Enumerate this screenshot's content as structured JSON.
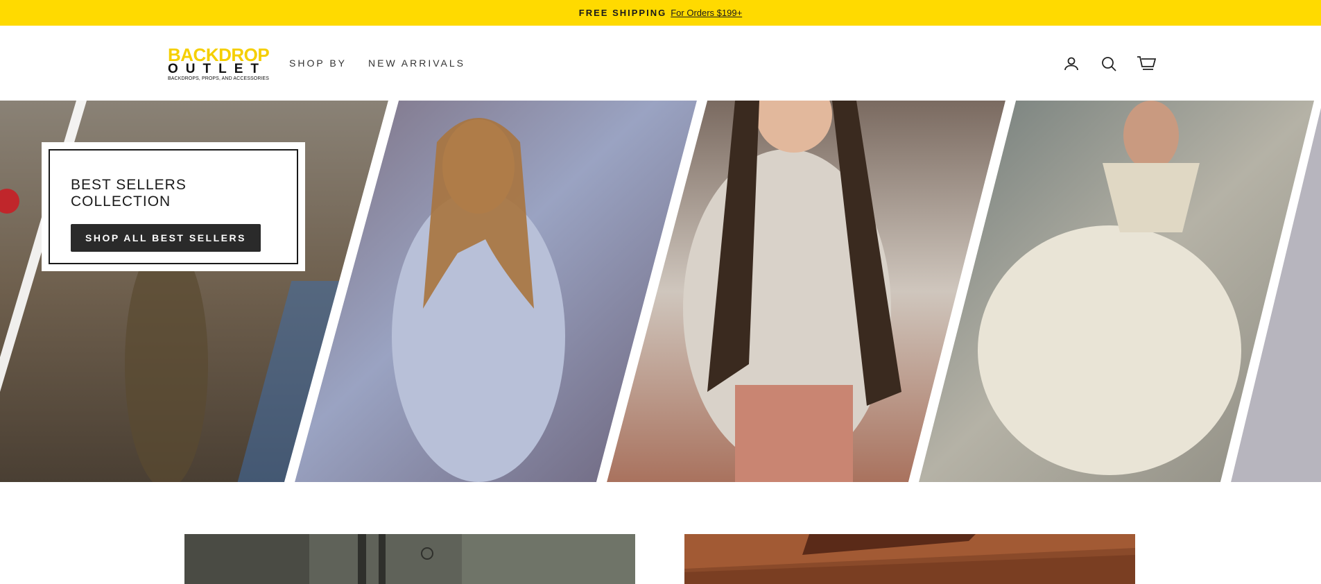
{
  "announcement": {
    "strong_text": "FREE SHIPPING",
    "link_text": "For Orders $199+"
  },
  "header": {
    "logo": {
      "line1": "BACKDROP",
      "line2": "OUTLET",
      "tagline": "BACKDROPS, PROPS, AND ACCESSORIES"
    },
    "nav": [
      {
        "label": "SHOP BY"
      },
      {
        "label": "NEW ARRIVALS"
      }
    ],
    "icons": [
      "account-icon",
      "search-icon",
      "cart-icon"
    ]
  },
  "hero": {
    "promo_title": "BEST SELLERS COLLECTION",
    "promo_button": "SHOP ALL BEST SELLERS"
  },
  "colors": {
    "accent": "#ffda00",
    "button": "#2a2a2a"
  }
}
